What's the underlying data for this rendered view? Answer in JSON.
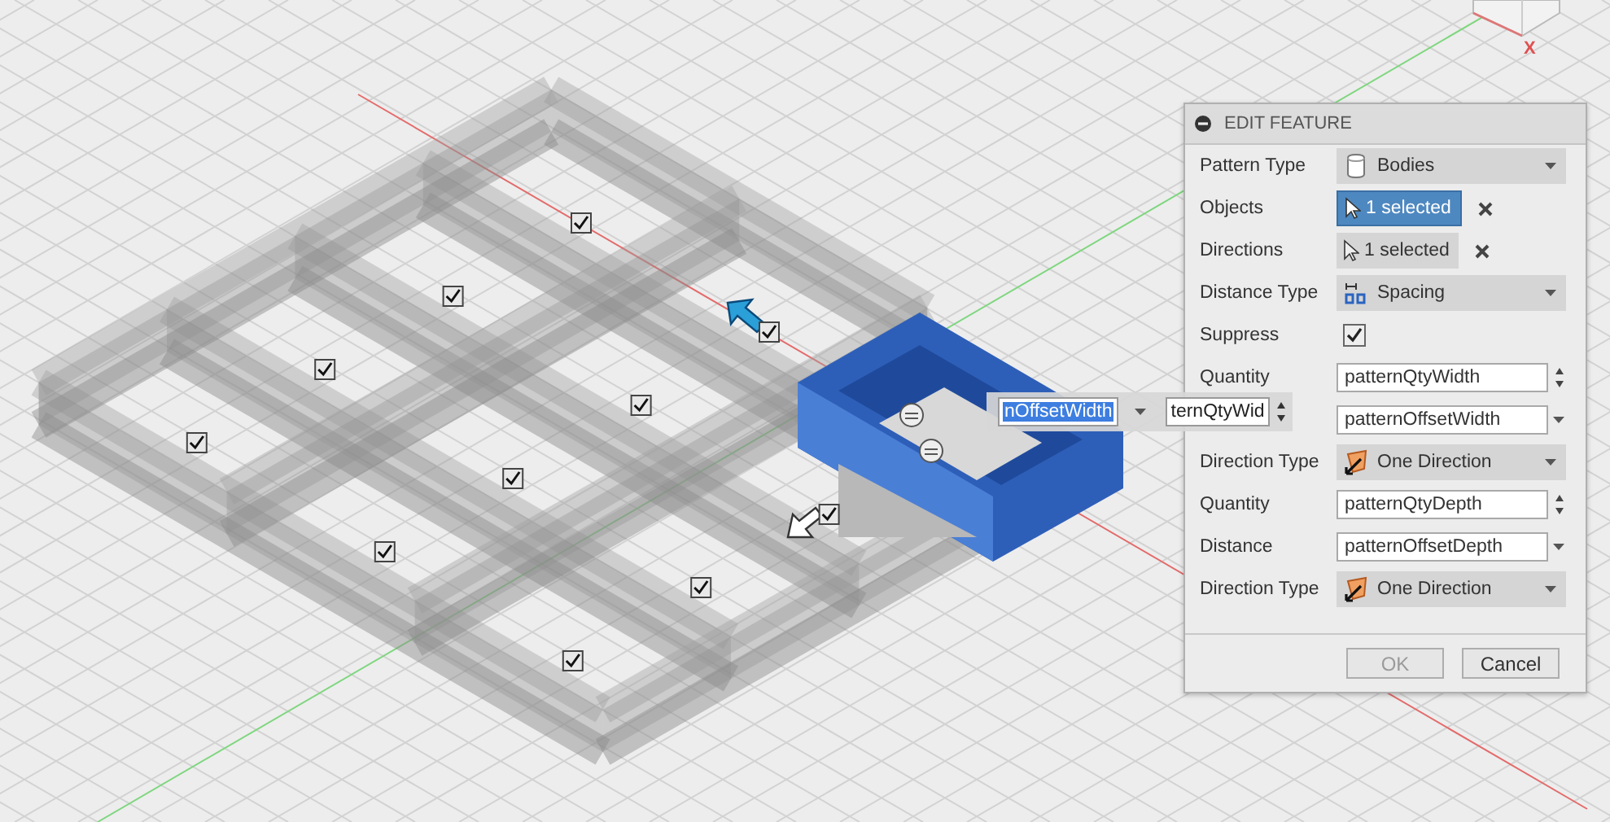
{
  "viewport": {
    "axis_label": "X",
    "pattern_instances": [
      {
        "checked": true
      },
      {
        "checked": true
      },
      {
        "checked": true
      },
      {
        "checked": true
      },
      {
        "checked": true
      },
      {
        "checked": true
      },
      {
        "checked": true
      },
      {
        "checked": true
      },
      {
        "checked": true
      },
      {
        "checked": true
      },
      {
        "checked": true
      }
    ],
    "canvas_inputs": [
      {
        "kind": "combo",
        "value": "nOffsetWidth",
        "selected": true
      },
      {
        "kind": "spinner",
        "value": "ternQtyWid",
        "selected": false
      }
    ]
  },
  "panel": {
    "title": "EDIT FEATURE",
    "rows": [
      {
        "label": "Pattern Type",
        "kind": "dropdown",
        "value": "Bodies"
      },
      {
        "label": "Objects",
        "kind": "selection",
        "value": "1 selected",
        "selected": true
      },
      {
        "label": "Directions",
        "kind": "selection",
        "value": "1 selected",
        "selected": false
      },
      {
        "label": "Distance Type",
        "kind": "dropdown",
        "value": "Spacing"
      },
      {
        "label": "Suppress",
        "kind": "checkbox",
        "checked": true
      },
      {
        "label": "Quantity",
        "kind": "spinner",
        "value": "patternQtyWidth"
      },
      {
        "kind": "combo",
        "value": "patternOffsetWidth"
      },
      {
        "label": "Direction Type",
        "kind": "dropdown",
        "value": "One Direction"
      },
      {
        "label": "Quantity",
        "kind": "spinner",
        "value": "patternQtyDepth"
      },
      {
        "label": "Distance",
        "kind": "combo",
        "value": "patternOffsetDepth"
      },
      {
        "label": "Direction Type",
        "kind": "dropdown",
        "value": "One Direction"
      }
    ],
    "buttons": [
      {
        "label": "OK",
        "disabled": true
      },
      {
        "label": "Cancel",
        "disabled": false
      }
    ]
  }
}
